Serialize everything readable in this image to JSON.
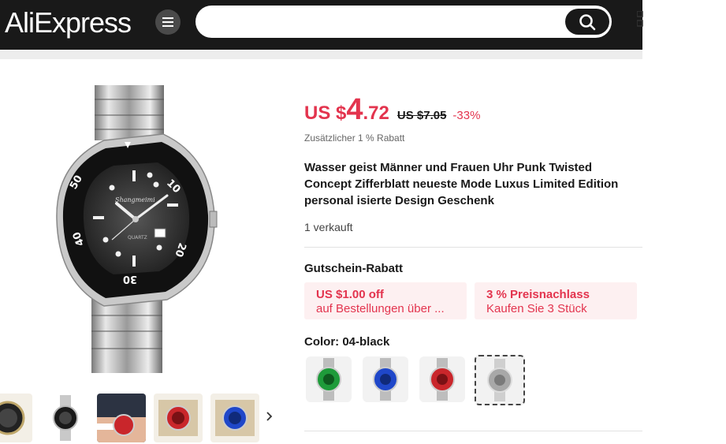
{
  "header": {
    "logo": "AliExpress",
    "menu_icon": "hamburger-icon",
    "search_placeholder": "",
    "search_icon": "search-icon"
  },
  "product": {
    "price": {
      "currency": "US $",
      "integer": "4",
      "decimal": ".72",
      "original": "US $7.05",
      "discount": "-33%"
    },
    "extra_discount": "Zusätzlicher 1 % Rabatt",
    "title": "Wasser geist Männer und Frauen Uhr Punk Twisted Concept Zifferblatt neueste Mode Luxus Limited Edition personal isierte Design Geschenk",
    "sold": "1 verkauft",
    "coupons_title": "Gutschein-Rabatt",
    "coupons": [
      {
        "amount": "US $1.00 off",
        "desc": "auf Bestellungen über ..."
      },
      {
        "amount": "3 % Preisnachlass",
        "desc": "Kaufen Sie 3 Stück"
      }
    ],
    "color_label": "Color: 04-black",
    "swatches": [
      {
        "name": "green",
        "color": "#1e9b3a"
      },
      {
        "name": "blue",
        "color": "#1f47c9"
      },
      {
        "name": "red",
        "color": "#c9262b"
      },
      {
        "name": "silver",
        "color": "#a8a8a8"
      }
    ],
    "thumbnails": [
      "black-gold",
      "black-silver",
      "red-on-wrist",
      "red-box",
      "blue-box"
    ],
    "dial": {
      "brand": "Shangmeimi",
      "movement": "QUARTZ",
      "bezel_numbers": [
        "10",
        "20",
        "30",
        "40",
        "50"
      ]
    }
  },
  "colors": {
    "accent": "#e3344e",
    "header_bg": "#191919",
    "coupon_bg": "#fdf0f1"
  }
}
